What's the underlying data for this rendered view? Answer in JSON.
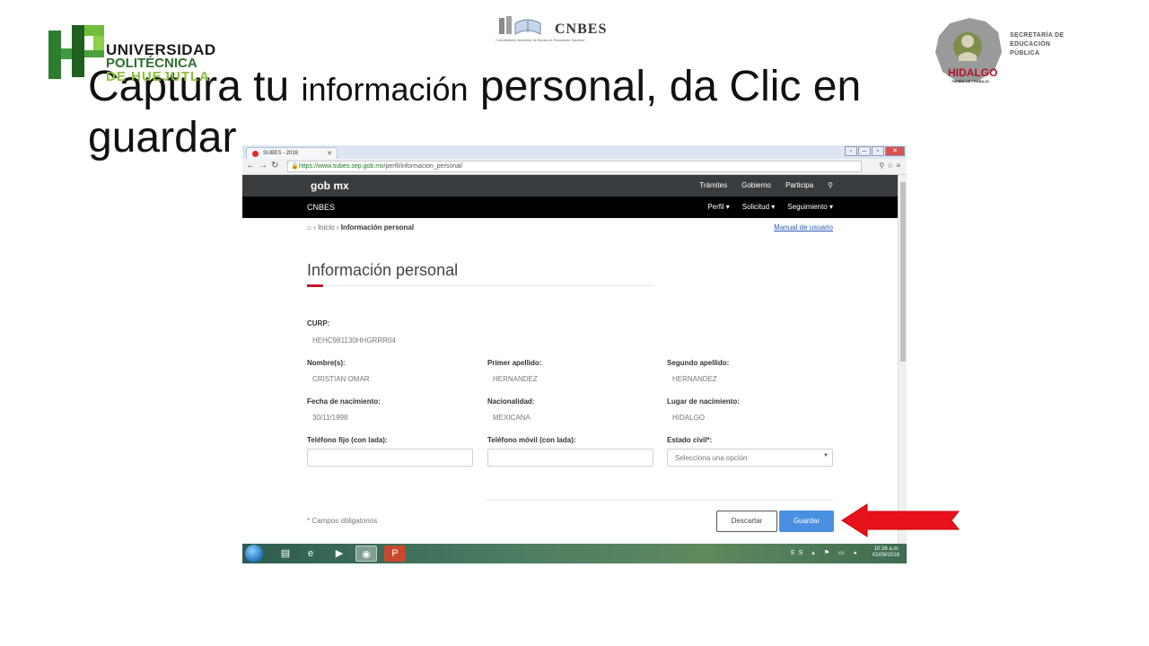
{
  "slide": {
    "title_part1": "Captura tu ",
    "title_part2": "información",
    "title_part3": " personal, da Clic en guardar"
  },
  "logos": {
    "left": {
      "line1": "UNIVERSIDAD",
      "line2": "POLITÉCNICA",
      "line3": "DE HUEJUTLA"
    },
    "center": {
      "name": "CNBES",
      "subtitle": "Coordinación Nacional de Becas de Educación Superior"
    },
    "right": {
      "line1": "SECRETARÍA DE",
      "line2": "EDUCACIÓN",
      "line3": "PÚBLICA",
      "state": "HIDALGO",
      "state_sub": "TIERRA DE TRABAJO"
    }
  },
  "browser": {
    "tab_title": "SUBES - 2016",
    "url_host": "https://www.subes.sep.gob.mx",
    "url_path": "/perfil/informacion_personal/"
  },
  "site": {
    "brand": "gob mx",
    "top_links": [
      "Trámites",
      "Gobierno",
      "Participa"
    ],
    "section": "CNBES",
    "section_links": [
      "Perfil ▾",
      "Solicitud ▾",
      "Seguimiento ▾"
    ]
  },
  "breadcrumb": {
    "home": "Inicio",
    "current": "Información personal"
  },
  "manual_link": "Manual de usuario",
  "page_title": "Información personal",
  "form": {
    "curp": {
      "label": "CURP:",
      "value": "HEHC981130HHGRRR04"
    },
    "nombre": {
      "label": "Nombre(s):",
      "value": "CRISTIAN OMAR"
    },
    "primer_apellido": {
      "label": "Primer apellido:",
      "value": "HERNANDEZ"
    },
    "segundo_apellido": {
      "label": "Segundo apellido:",
      "value": "HERNANDEZ"
    },
    "fecha_nacimiento": {
      "label": "Fecha de nacimiento:",
      "value": "30/11/1998"
    },
    "nacionalidad": {
      "label": "Nacionalidad:",
      "value": "MEXICANA"
    },
    "lugar_nacimiento": {
      "label": "Lugar de nacimiento:",
      "value": "HIDALGO"
    },
    "telefono_fijo": {
      "label": "Teléfono fijo (con lada):",
      "value": ""
    },
    "telefono_movil": {
      "label": "Teléfono móvil (con lada):",
      "value": ""
    },
    "estado_civil": {
      "label": "Estado civil*:",
      "selected": "Selecciona una opción"
    }
  },
  "required_note": "* Campos obligatorios",
  "buttons": {
    "discard": "Descartar",
    "save": "Guardar"
  },
  "taskbar": {
    "lang": "ES",
    "time": "10:26 a.m.",
    "date": "01/09/2016"
  },
  "colors": {
    "accent_red": "#c0172b",
    "save_blue": "#4a90e2",
    "arrow_red": "#e8121c"
  }
}
